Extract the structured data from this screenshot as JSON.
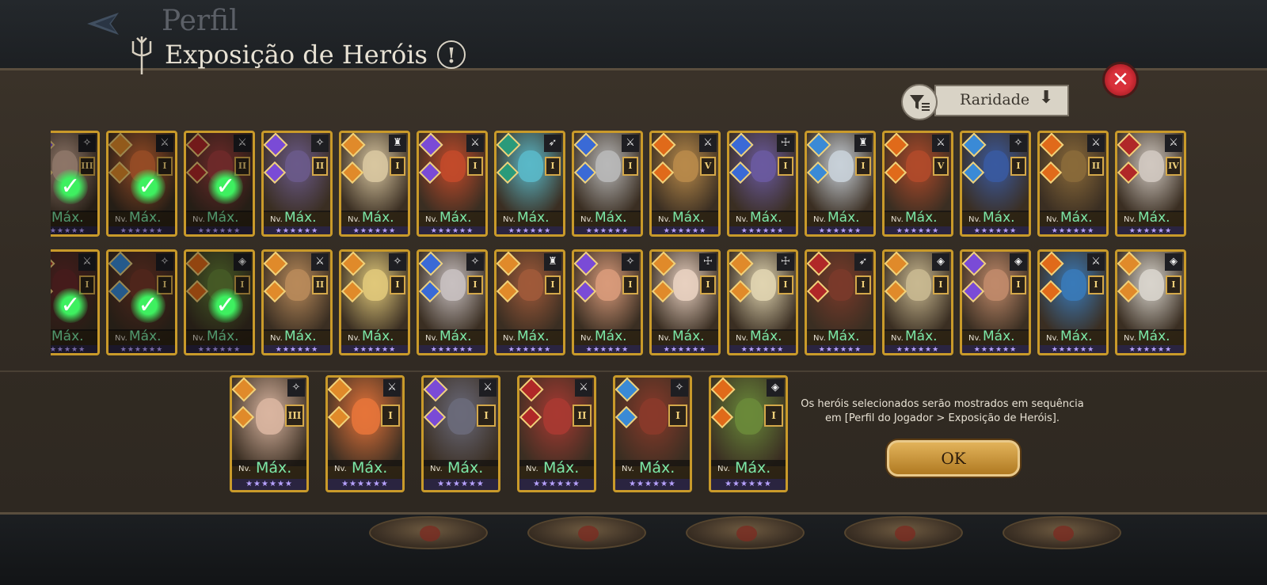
{
  "header": {
    "back_label": "Perfil",
    "title": "Exposição de Heróis",
    "info_icon": "!"
  },
  "sort": {
    "label": "Raridade",
    "arrow": "⬇"
  },
  "close_icon": "✕",
  "card_text": {
    "nv": "Nv.",
    "max": "Máx.",
    "stars": "★★★★★★"
  },
  "roster": {
    "row1": [
      {
        "tier": "III",
        "role": "✧",
        "elem": "#7a4bd6",
        "face": "#d9b5a0",
        "selected": true
      },
      {
        "tier": "I",
        "role": "⚔",
        "elem": "#e08a2a",
        "face": "#e6743a",
        "selected": true
      },
      {
        "tier": "II",
        "role": "⚔",
        "elem": "#b02828",
        "face": "#a84040",
        "selected": true
      },
      {
        "tier": "II",
        "role": "✧",
        "elem": "#7a4bd6",
        "face": "#6a5a8a",
        "selected": false
      },
      {
        "tier": "I",
        "role": "♜",
        "elem": "#e08a2a",
        "face": "#d8c6a0",
        "selected": false
      },
      {
        "tier": "I",
        "role": "⚔",
        "elem": "#7a4bd6",
        "face": "#c24a2a",
        "selected": false
      },
      {
        "tier": "I",
        "role": "➶",
        "elem": "#2a9a7a",
        "face": "#5ab8c8",
        "selected": false
      },
      {
        "tier": "I",
        "role": "⚔",
        "elem": "#3a6ad6",
        "face": "#b8b8b8",
        "selected": false
      },
      {
        "tier": "V",
        "role": "⚔",
        "elem": "#e06a1a",
        "face": "#b88a4a",
        "selected": false
      },
      {
        "tier": "I",
        "role": "☩",
        "elem": "#3a6ad6",
        "face": "#6a5aa0",
        "selected": false
      },
      {
        "tier": "I",
        "role": "♜",
        "elem": "#3a8ad6",
        "face": "#c8d0d8",
        "selected": false
      },
      {
        "tier": "V",
        "role": "⚔",
        "elem": "#e06a1a",
        "face": "#b04a2a",
        "selected": false
      },
      {
        "tier": "I",
        "role": "✧",
        "elem": "#3a8ad6",
        "face": "#3a5aa0",
        "selected": false
      },
      {
        "tier": "II",
        "role": "⚔",
        "elem": "#e06a1a",
        "face": "#8a6a3a",
        "selected": false
      },
      {
        "tier": "IV",
        "role": "⚔",
        "elem": "#b02828",
        "face": "#d0c8c0",
        "selected": false
      }
    ],
    "row2": [
      {
        "tier": "I",
        "role": "⚔",
        "elem": "#b02828",
        "face": "#6a2a2a",
        "selected": true
      },
      {
        "tier": "I",
        "role": "✧",
        "elem": "#3a8ad6",
        "face": "#7a3a2a",
        "selected": true
      },
      {
        "tier": "I",
        "role": "◈",
        "elem": "#e06a1a",
        "face": "#6a8a3a",
        "selected": true
      },
      {
        "tier": "II",
        "role": "⚔",
        "elem": "#e08a2a",
        "face": "#b88a5a",
        "selected": false
      },
      {
        "tier": "I",
        "role": "✧",
        "elem": "#e08a2a",
        "face": "#e0c87a",
        "selected": false
      },
      {
        "tier": "I",
        "role": "✧",
        "elem": "#3a6ad6",
        "face": "#c8c0c0",
        "selected": false
      },
      {
        "tier": "I",
        "role": "♜",
        "elem": "#e08a2a",
        "face": "#a05a3a",
        "selected": false
      },
      {
        "tier": "I",
        "role": "✧",
        "elem": "#7a4bd6",
        "face": "#d89a7a",
        "selected": false
      },
      {
        "tier": "I",
        "role": "☩",
        "elem": "#e08a2a",
        "face": "#e8d0c0",
        "selected": false
      },
      {
        "tier": "I",
        "role": "☩",
        "elem": "#e08a2a",
        "face": "#e0d4b0",
        "selected": false
      },
      {
        "tier": "I",
        "role": "➶",
        "elem": "#b02828",
        "face": "#7a3a2a",
        "selected": false
      },
      {
        "tier": "I",
        "role": "◈",
        "elem": "#e08a2a",
        "face": "#c8b890",
        "selected": false
      },
      {
        "tier": "I",
        "role": "◈",
        "elem": "#7a4bd6",
        "face": "#c08a6a",
        "selected": false
      },
      {
        "tier": "I",
        "role": "⚔",
        "elem": "#e06a1a",
        "face": "#3a7ab8",
        "selected": false
      },
      {
        "tier": "I",
        "role": "◈",
        "elem": "#e08a2a",
        "face": "#d8d4cc",
        "selected": false
      }
    ]
  },
  "selected": [
    {
      "tier": "III",
      "role": "✧",
      "elem": "#e08a2a",
      "face": "#d9b5a0"
    },
    {
      "tier": "I",
      "role": "⚔",
      "elem": "#e08a2a",
      "face": "#e6743a"
    },
    {
      "tier": "I",
      "role": "⚔",
      "elem": "#7a4bd6",
      "face": "#6a6a7a"
    },
    {
      "tier": "II",
      "role": "⚔",
      "elem": "#b02828",
      "face": "#a83a32"
    },
    {
      "tier": "I",
      "role": "✧",
      "elem": "#3a8ad6",
      "face": "#8a3a2a"
    },
    {
      "tier": "I",
      "role": "◈",
      "elem": "#e06a1a",
      "face": "#6a8a3a"
    }
  ],
  "notice": {
    "line1": "Os heróis selecionados serão mostrados em sequência",
    "line2": "em [Perfil do Jogador > Exposição de Heróis]."
  },
  "ok_label": "OK",
  "pedestal_count": 5,
  "colors": {
    "accent_gold": "#c99a2a",
    "max_green": "#7ce8a8",
    "close_red": "#d8303a"
  }
}
